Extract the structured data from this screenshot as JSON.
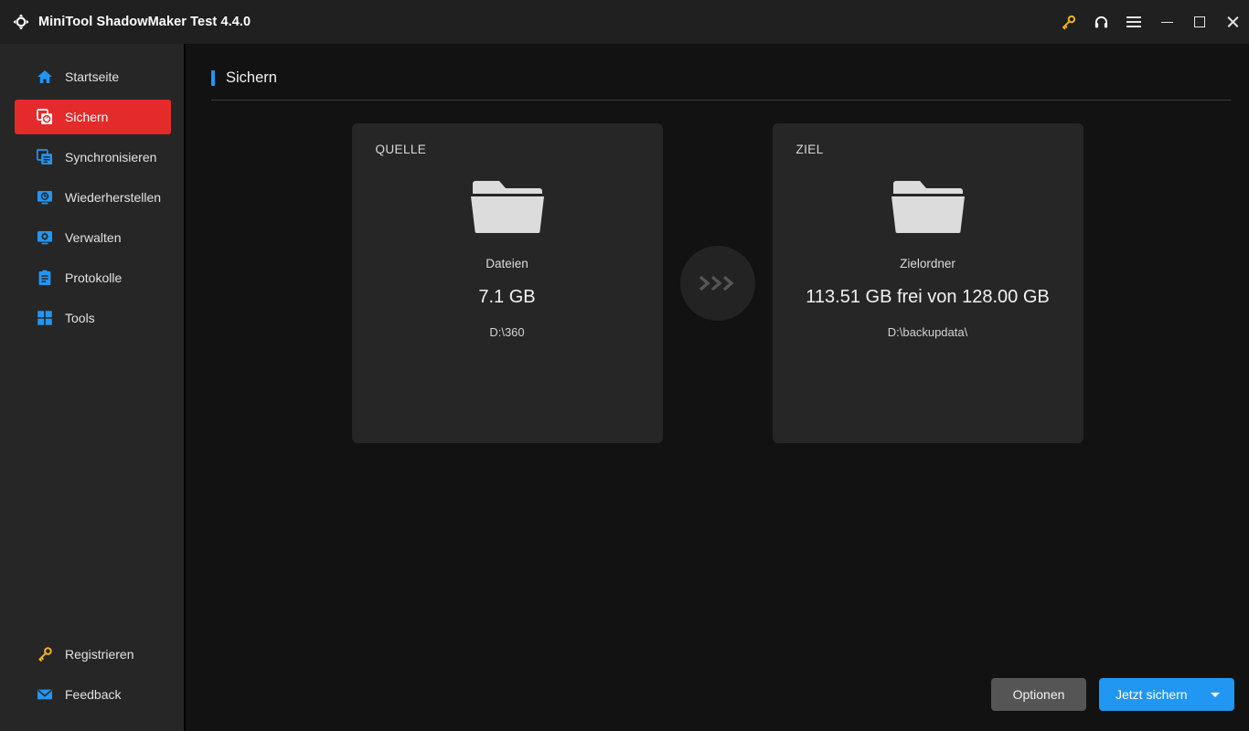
{
  "window": {
    "title": "MiniTool ShadowMaker Test 4.4.0",
    "logo_icon": "refresh-arrows-icon",
    "actions": [
      {
        "name": "license-key-icon",
        "label": "Registrieren",
        "color": "#f0b323"
      },
      {
        "name": "headset-support-icon",
        "label": "Support",
        "color": "#ffffff"
      },
      {
        "name": "hamburger-menu-icon",
        "label": "Menü",
        "color": "#e6e6e6"
      },
      {
        "name": "minimize-icon",
        "label": "Minimieren",
        "color": "#e6e6e6"
      },
      {
        "name": "maximize-icon",
        "label": "Maximieren",
        "color": "#e6e6e6"
      },
      {
        "name": "close-icon",
        "label": "Schließen",
        "color": "#e6e6e6"
      }
    ]
  },
  "sidebar": {
    "items": [
      {
        "label": "Startseite",
        "icon": "home-icon",
        "active": false
      },
      {
        "label": "Sichern",
        "icon": "backup-icon",
        "active": true
      },
      {
        "label": "Synchronisieren",
        "icon": "sync-icon",
        "active": false
      },
      {
        "label": "Wiederherstellen",
        "icon": "restore-icon",
        "active": false
      },
      {
        "label": "Verwalten",
        "icon": "manage-icon",
        "active": false
      },
      {
        "label": "Protokolle",
        "icon": "logs-icon",
        "active": false
      },
      {
        "label": "Tools",
        "icon": "tools-grid-icon",
        "active": false
      }
    ],
    "bottom_items": [
      {
        "label": "Registrieren",
        "icon": "key-icon"
      },
      {
        "label": "Feedback",
        "icon": "envelope-icon"
      }
    ],
    "active_color": "#e42a2a",
    "icon_color": "#2196f3",
    "key_color": "#f0b323"
  },
  "page": {
    "title": "Sichern",
    "accent_color": "#2196f3"
  },
  "source_card": {
    "kicker": "QUELLE",
    "icon": "folder-icon",
    "subtitle": "Dateien",
    "main_value": "7.1 GB",
    "path": "D:\\360"
  },
  "transfer_arrow": {
    "icon": "triple-chevron-right-icon"
  },
  "destination_card": {
    "kicker": "ZIEL",
    "icon": "folder-icon",
    "subtitle": "Zielordner",
    "main_value": "113.51 GB frei von 128.00 GB",
    "path": "D:\\backupdata\\"
  },
  "footer": {
    "options_label": "Optionen",
    "backup_now_label": "Jetzt sichern",
    "dropdown_icon": "caret-down-icon",
    "primary_color": "#2196f3",
    "secondary_color": "#555555"
  }
}
